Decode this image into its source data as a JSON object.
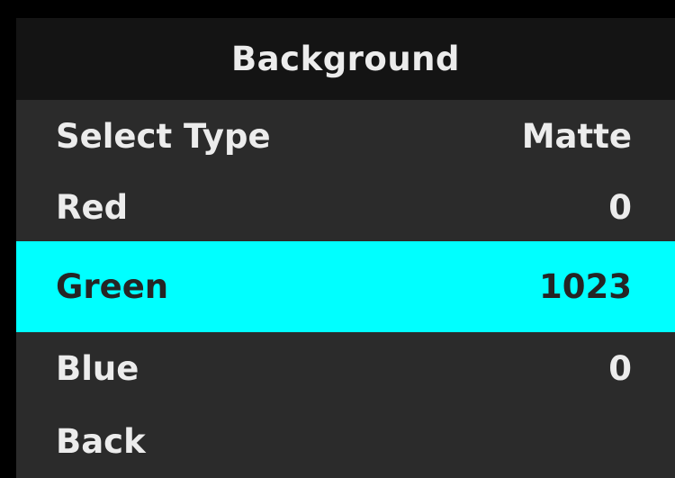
{
  "menu": {
    "title": "Background",
    "items": [
      {
        "label": "Select Type",
        "value": "Matte"
      },
      {
        "label": "Red",
        "value": "0"
      },
      {
        "label": "Green",
        "value": "1023",
        "selected": true
      },
      {
        "label": "Blue",
        "value": "0"
      },
      {
        "label": "Back",
        "value": ""
      }
    ]
  },
  "colors": {
    "highlight": "#00ffff",
    "background": "#2b2b2b",
    "title_background": "#141414",
    "text": "#ececec"
  }
}
